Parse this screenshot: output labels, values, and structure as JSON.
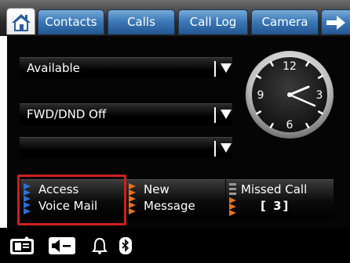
{
  "tabs": [
    {
      "label": "Contacts"
    },
    {
      "label": "Calls"
    },
    {
      "label": "Call Log"
    },
    {
      "label": "Camera"
    }
  ],
  "icons": {
    "home": "home-icon",
    "next": "arrow-right-icon"
  },
  "dropdowns": [
    {
      "value": "Available"
    },
    {
      "value": "FWD/DND Off"
    },
    {
      "value": ""
    }
  ],
  "clock": {
    "numerals": [
      "12",
      "3",
      "6",
      "9"
    ]
  },
  "buttons": {
    "voicemail": {
      "line1": "Access",
      "line2": "Voice Mail"
    },
    "message": {
      "line1": "New",
      "line2": "Message"
    },
    "missed": {
      "line1": "Missed Call",
      "line2": "[ 3]"
    }
  },
  "statusbar": [
    "door-phone-icon",
    "speaker-mute-icon",
    "bell-icon",
    "bluetooth-icon"
  ],
  "colors": {
    "tab_blue": "#3d7ab8",
    "focus_red": "#cc1f1f",
    "voicemail_stripe": "#2f6fd6",
    "message_stripe": "#e8701a"
  }
}
